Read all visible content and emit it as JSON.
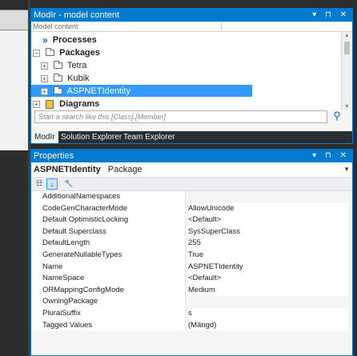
{
  "model_window": {
    "title": "ModIr - model content",
    "controls": "▾ ⊓ ✕",
    "column_header": "Model content",
    "tree": [
      {
        "label": "Processes",
        "kind": "processes"
      },
      {
        "label": "Packages",
        "kind": "folder-root",
        "expander": "−"
      },
      {
        "label": "Tetra",
        "kind": "folder",
        "expander": "+"
      },
      {
        "label": "Kubik",
        "kind": "folder",
        "expander": "+"
      },
      {
        "label": "ASPNETIdentity",
        "kind": "folder",
        "expander": "+",
        "selected": true
      },
      {
        "label": "Diagrams",
        "kind": "diagrams",
        "expander": "+"
      }
    ],
    "search_placeholder": "Start a search like this [Class].[Member]",
    "tabs": [
      "ModIr",
      "Solution Explorer",
      "Team Explorer"
    ]
  },
  "properties_window": {
    "title": "Properties",
    "controls": "▾ ⊓ ✕",
    "object_name": "ASPNETIdentity",
    "object_type": "Package",
    "rows": [
      {
        "key": "AdditionalNamespaces",
        "value": ""
      },
      {
        "key": "CodeGenCharacterMode",
        "value": "AllowUnicode"
      },
      {
        "key": "Default OptimisticLocking",
        "value": "<Default>"
      },
      {
        "key": "Default Superclass",
        "value": "SysSuperClass"
      },
      {
        "key": "DefaultLength",
        "value": "255"
      },
      {
        "key": "GenerateNullableTypes",
        "value": "True"
      },
      {
        "key": "Name",
        "value": "ASPNETIdentity"
      },
      {
        "key": "NameSpace",
        "value": "<Default>"
      },
      {
        "key": "ORMappingConfigMode",
        "value": "Medium"
      },
      {
        "key": "OwningPackage",
        "value": ""
      },
      {
        "key": "PluralSuffix",
        "value": "s"
      },
      {
        "key": "Tagged Values",
        "value": "(Mängd)"
      }
    ]
  },
  "colors": {
    "accent": "#007acc",
    "selection": "#3399ff",
    "chrome": "#2d2d30"
  }
}
